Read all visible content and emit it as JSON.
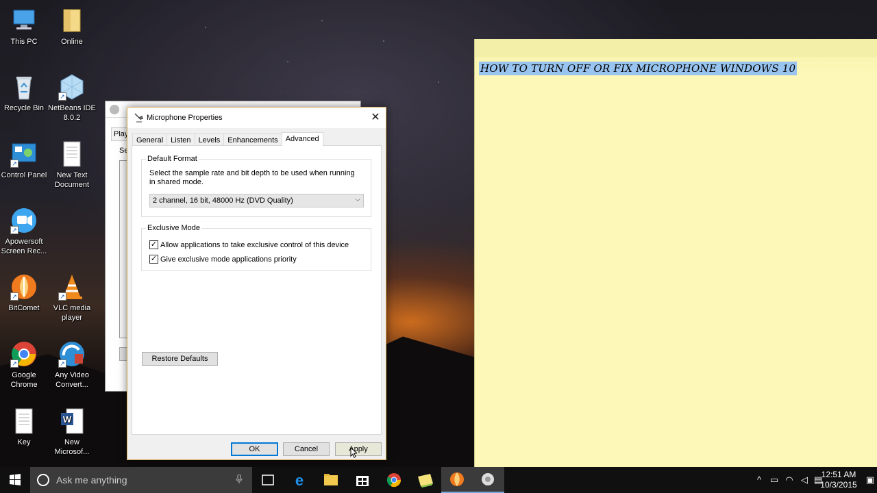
{
  "desktop": {
    "icons": [
      {
        "label": "This PC"
      },
      {
        "label": "Online"
      },
      {
        "label": "Recycle Bin"
      },
      {
        "label": "NetBeans IDE 8.0.2"
      },
      {
        "label": "Control Panel"
      },
      {
        "label": "New Text Document"
      },
      {
        "label": "Apowersoft Screen Rec..."
      },
      {
        "label": "BitComet"
      },
      {
        "label": "VLC media player"
      },
      {
        "label": "Google Chrome"
      },
      {
        "label": "Any Video Convert..."
      },
      {
        "label": "Key"
      },
      {
        "label": "New Microsof..."
      }
    ]
  },
  "background_window": {
    "tab_label": "Play",
    "section_label": "Se"
  },
  "dialog": {
    "title": "Microphone Properties",
    "tabs": [
      {
        "label": "General"
      },
      {
        "label": "Listen"
      },
      {
        "label": "Levels"
      },
      {
        "label": "Enhancements"
      },
      {
        "label": "Advanced"
      }
    ],
    "default_format": {
      "group_label": "Default Format",
      "description": "Select the sample rate and bit depth to be used when running in shared mode.",
      "selected_format": "2 channel, 16 bit, 48000 Hz (DVD Quality)"
    },
    "exclusive_mode": {
      "group_label": "Exclusive Mode",
      "allow_exclusive_label": "Allow applications to take exclusive control of this device",
      "allow_exclusive_checked": true,
      "priority_label": "Give exclusive mode applications priority",
      "priority_checked": true
    },
    "restore_defaults_label": "Restore Defaults",
    "ok_label": "OK",
    "cancel_label": "Cancel",
    "apply_label": "Apply"
  },
  "sticky_note": {
    "text": "HOW TO TURN OFF OR FIX MICROPHONE WINDOWS 10"
  },
  "taskbar": {
    "search_placeholder": "Ask me anything",
    "clock_time": "12:51 AM",
    "clock_date": "10/3/2015"
  },
  "colors": {
    "accent": "#0078d7",
    "sticky_bg": "#fdf8b8",
    "highlight": "#99c4f0",
    "taskbar": "#101010"
  }
}
